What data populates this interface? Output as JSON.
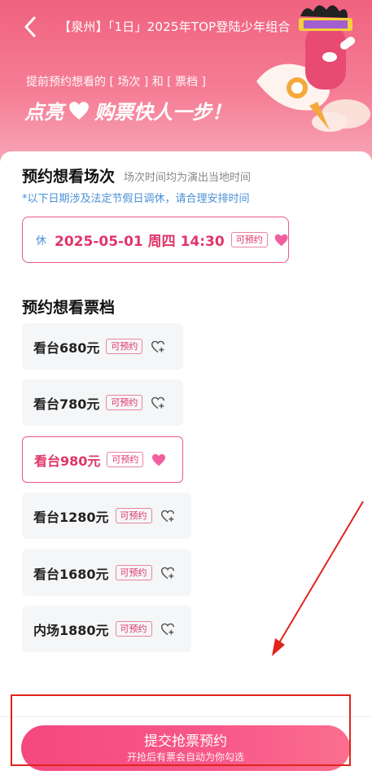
{
  "header": {
    "title": "【泉州】「1日」2025年TOP登陆少年组合",
    "subtitle": "提前预约想看的 [ 场次 ] 和 [ 票档 ]",
    "slogan_left": "点亮",
    "slogan_right": "购票快人一步！"
  },
  "session_section": {
    "title": "预约想看场次",
    "subtitle": "场次时间均为演出当地时间",
    "notice": "*以下日期涉及法定节假日调休，请合理安排时间",
    "sessions": [
      {
        "rest_tag": "休",
        "label": "2025-05-01 周四 14:30",
        "badge": "可预约",
        "selected": true
      }
    ]
  },
  "tier_section": {
    "title": "预约想看票档",
    "tiers": [
      {
        "label": "看台680元",
        "badge": "可预约",
        "selected": false
      },
      {
        "label": "看台780元",
        "badge": "可预约",
        "selected": false
      },
      {
        "label": "看台980元",
        "badge": "可预约",
        "selected": true
      },
      {
        "label": "看台1280元",
        "badge": "可预约",
        "selected": false
      },
      {
        "label": "看台1680元",
        "badge": "可预约",
        "selected": false
      },
      {
        "label": "内场1880元",
        "badge": "可预约",
        "selected": false
      }
    ]
  },
  "submit": {
    "label": "提交抢票预约",
    "sub_label": "开抢后有票会自动为你勾选"
  },
  "colors": {
    "accent": "#e0356a",
    "hero": "#f0627f",
    "notice": "#4a8fd6",
    "annotation": "#e0241c"
  },
  "icons": {
    "back": "chevron-left-icon",
    "heart_filled": "heart-filled-icon",
    "heart_add": "heart-plus-icon"
  }
}
